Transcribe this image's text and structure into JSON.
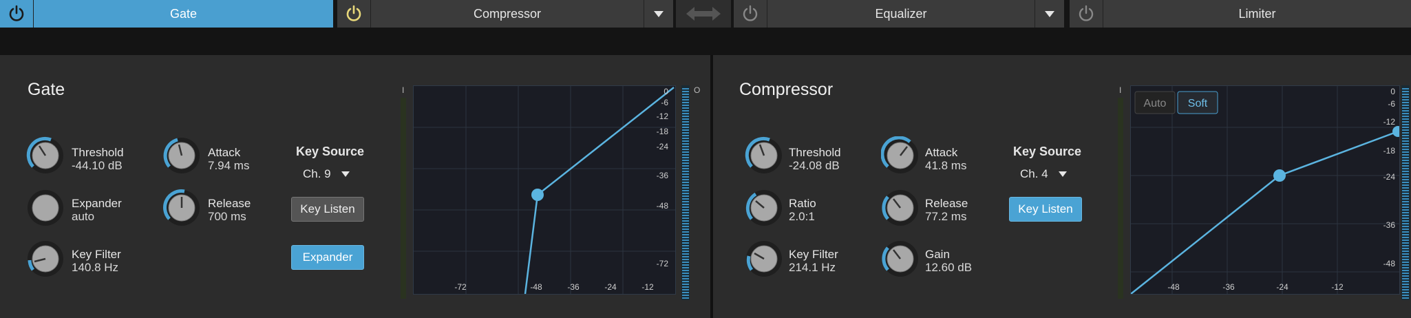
{
  "tabs": [
    {
      "label": "Gate",
      "active": true
    },
    {
      "label": "Compressor",
      "active": false,
      "has_dropdown": true
    },
    {
      "label": "Equalizer",
      "active": false,
      "has_dropdown": true
    },
    {
      "label": "Limiter",
      "active": false
    }
  ],
  "gate": {
    "title": "Gate",
    "knobs": {
      "threshold": {
        "label": "Threshold",
        "value": "-44.10 dB"
      },
      "attack": {
        "label": "Attack",
        "value": "7.94 ms"
      },
      "expander": {
        "label": "Expander",
        "value": "auto"
      },
      "release": {
        "label": "Release",
        "value": "700 ms"
      },
      "key_filter": {
        "label": "Key Filter",
        "value": "140.8 Hz"
      }
    },
    "key_source": {
      "title": "Key Source",
      "value": "Ch. 9"
    },
    "key_listen_label": "Key Listen",
    "expander_button_label": "Expander",
    "graph": {
      "y_ticks": [
        "0",
        "-6",
        "-12",
        "-18",
        "-24",
        "-36",
        "-48",
        "-72"
      ],
      "x_ticks": [
        "-72",
        "-48",
        "-36",
        "-24",
        "-12"
      ],
      "meter_label_left": "I",
      "meter_label_right": "O"
    }
  },
  "compressor": {
    "title": "Compressor",
    "knobs": {
      "threshold": {
        "label": "Threshold",
        "value": "-24.08 dB"
      },
      "attack": {
        "label": "Attack",
        "value": "41.8 ms"
      },
      "ratio": {
        "label": "Ratio",
        "value": "2.0:1"
      },
      "release": {
        "label": "Release",
        "value": "77.2 ms"
      },
      "key_filter": {
        "label": "Key Filter",
        "value": "214.1 Hz"
      },
      "gain": {
        "label": "Gain",
        "value": "12.60 dB"
      }
    },
    "key_source": {
      "title": "Key Source",
      "value": "Ch. 4"
    },
    "key_listen_label": "Key Listen",
    "mode_auto_label": "Auto",
    "mode_soft_label": "Soft",
    "graph": {
      "y_ticks": [
        "0",
        "-6",
        "-12",
        "-18",
        "-24",
        "-36",
        "-48"
      ],
      "x_ticks": [
        "-48",
        "-36",
        "-24",
        "-12"
      ],
      "meter_label_left": "I"
    }
  },
  "colors": {
    "accent": "#4a9fd0",
    "panel": "#2c2c2c",
    "graph_bg": "#1a1c24",
    "curve": "#5bb4e0"
  }
}
